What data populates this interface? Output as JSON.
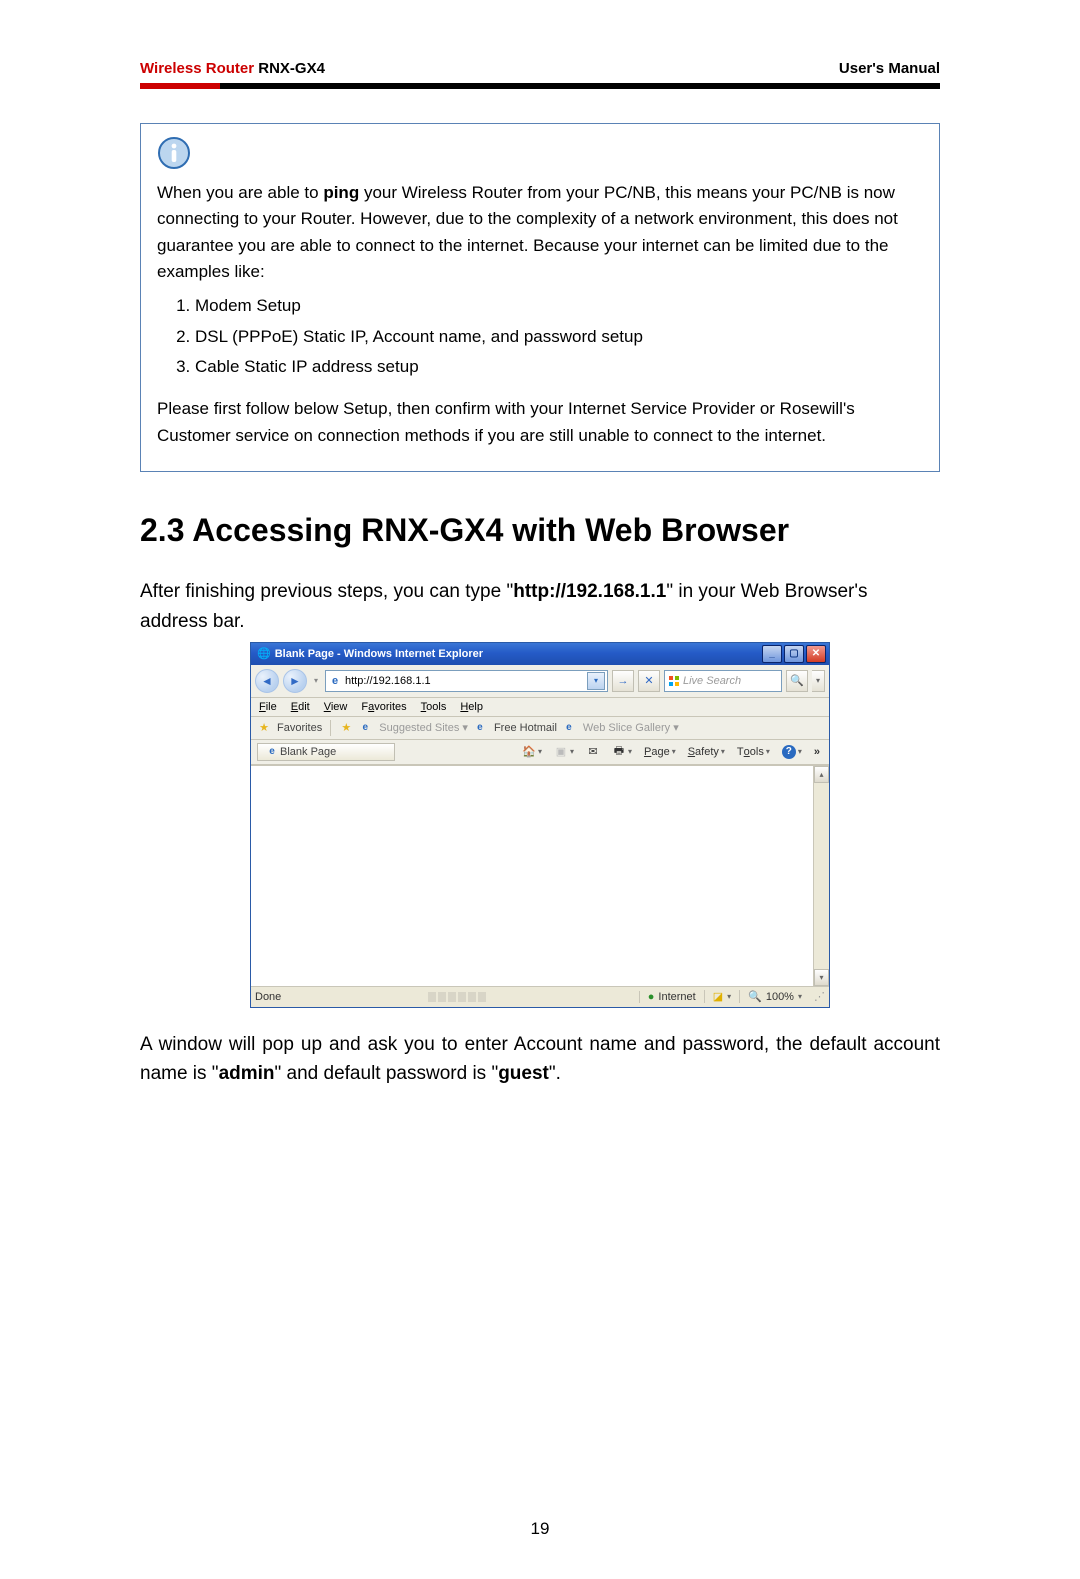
{
  "header": {
    "brand": "Wireless Router",
    "model": "RNX-GX4",
    "right": "User's Manual"
  },
  "info_box": {
    "p1_a": "When you are able to ",
    "p1_b": "ping",
    "p1_c": " your Wireless Router from your PC/NB, this means your PC/NB is now connecting to your Router. However, due to the complexity of a network environment, this does not guarantee you are able to connect to the internet. Because your internet can be limited due to the examples like:",
    "items": [
      "Modem Setup",
      "DSL (PPPoE) Static IP, Account name, and password setup",
      "Cable Static IP address setup"
    ],
    "p2": "Please first follow below Setup, then confirm with your Internet Service Provider or Rosewill's Customer service on connection methods if you are still unable to connect to the internet."
  },
  "section_heading": "2.3 Accessing RNX-GX4 with Web Browser",
  "body_a1": "After finishing previous steps, you can type \"",
  "body_a1_bold": "http://192.168.1.1",
  "body_a1_end": "\" in your Web Browser's address bar.",
  "body_b_pre": "A window will pop up and ask you to enter Account name and password, the default account name is \"",
  "body_b_admin": "admin",
  "body_b_mid": "\" and default password is \"",
  "body_b_guest": "guest",
  "body_b_end": "\".",
  "ie": {
    "title": "Blank Page - Windows Internet Explorer",
    "url": "http://192.168.1.1",
    "search_placeholder": "Live Search",
    "menu": {
      "file": "File",
      "edit": "Edit",
      "view": "View",
      "favorites": "Favorites",
      "tools": "Tools",
      "help": "Help"
    },
    "favbar": {
      "fav_label": "Favorites",
      "suggested": "Suggested Sites",
      "freehotmail": "Free Hotmail",
      "webslice": "Web Slice Gallery"
    },
    "tab_label": "Blank Page",
    "cmdbar": {
      "page": "Page",
      "safety": "Safety",
      "tools": "Tools"
    },
    "status": {
      "done": "Done",
      "internet": "Internet",
      "zoom": "100%"
    }
  },
  "page_number": "19"
}
